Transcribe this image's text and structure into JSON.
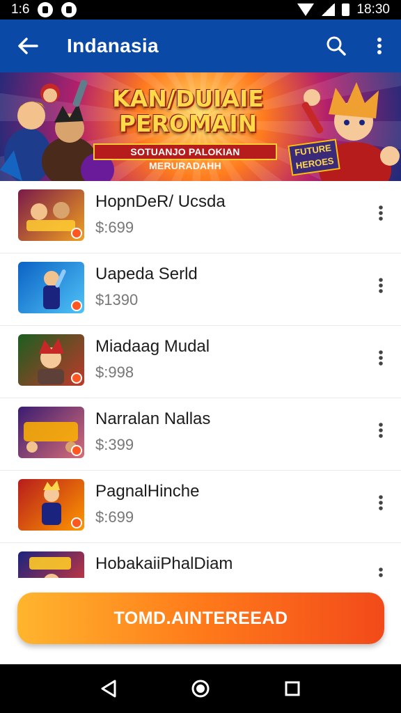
{
  "status_bar": {
    "time": "1:6",
    "clock": "18:30"
  },
  "app_bar": {
    "title": "Indanasia"
  },
  "banner": {
    "title": "KAN/DUIAIE PEROMAIN",
    "subtitle": "SOTUANJO PALOKIAN MERURADAHH",
    "badge": "FUTURE HEROES"
  },
  "items": [
    {
      "name": "HopnDeR/ Ucsda",
      "price": "$:699",
      "thumb_colors": [
        "#7a1a4a",
        "#f0a020"
      ]
    },
    {
      "name": "Uapeda Serld",
      "price": "$1390",
      "thumb_colors": [
        "#0b62c4",
        "#4fc3f7"
      ]
    },
    {
      "name": "Miadaag Mudal",
      "price": "$:998",
      "thumb_colors": [
        "#1b5e20",
        "#c0392b"
      ]
    },
    {
      "name": "Narralan Nallas",
      "price": "$:399",
      "thumb_colors": [
        "#3a1c71",
        "#d76d77"
      ]
    },
    {
      "name": "PagnalHinche",
      "price": "$:699",
      "thumb_colors": [
        "#b71c1c",
        "#ff9800"
      ]
    },
    {
      "name": "HobakaiiPhalDiam",
      "price": "",
      "thumb_colors": [
        "#1a237e",
        "#e53935"
      ]
    }
  ],
  "cta": {
    "label": "TOMD.AINTEREEAD"
  },
  "colors": {
    "app_bar": "#0a4aa6",
    "cta_start": "#ffb52e",
    "cta_end": "#f24a1a"
  },
  "icons": {
    "back": "arrow-left-icon",
    "search": "search-icon",
    "more": "more-vert-icon",
    "nav_back": "triangle-back-icon",
    "nav_home": "circle-home-icon",
    "nav_recents": "square-recents-icon"
  }
}
